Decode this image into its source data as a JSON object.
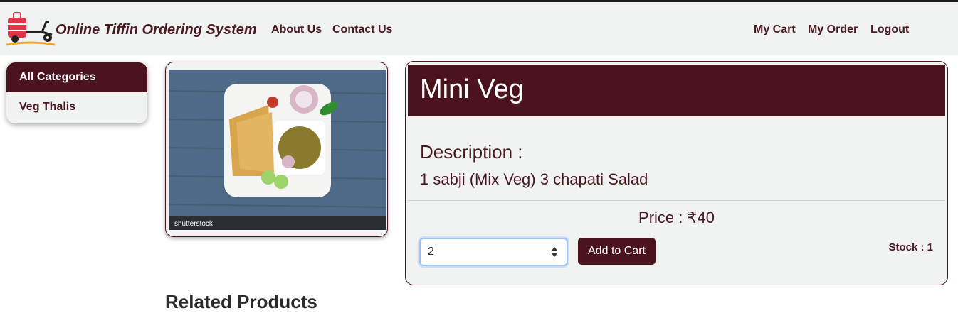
{
  "header": {
    "brand": "Online Tiffin Ordering System",
    "nav_left": [
      "About Us",
      "Contact Us"
    ],
    "nav_right": [
      "My Cart",
      "My Order",
      "Logout"
    ]
  },
  "sidebar": {
    "items": [
      {
        "label": "All Categories",
        "active": true
      },
      {
        "label": "Veg Thalis",
        "active": false
      }
    ]
  },
  "product": {
    "image_watermark": "shutterstock",
    "title": "Mini Veg",
    "description_label": "Description :",
    "description": "1 sabji (Mix Veg) 3 chapati Salad",
    "price": "Price : ₹40",
    "quantity": "2",
    "add_to_cart_label": "Add to Cart",
    "stock": "Stock : 1"
  },
  "related": {
    "heading": "Related Products"
  },
  "colors": {
    "accent": "#4a131d",
    "navbar_bg": "#f1f2f2"
  }
}
